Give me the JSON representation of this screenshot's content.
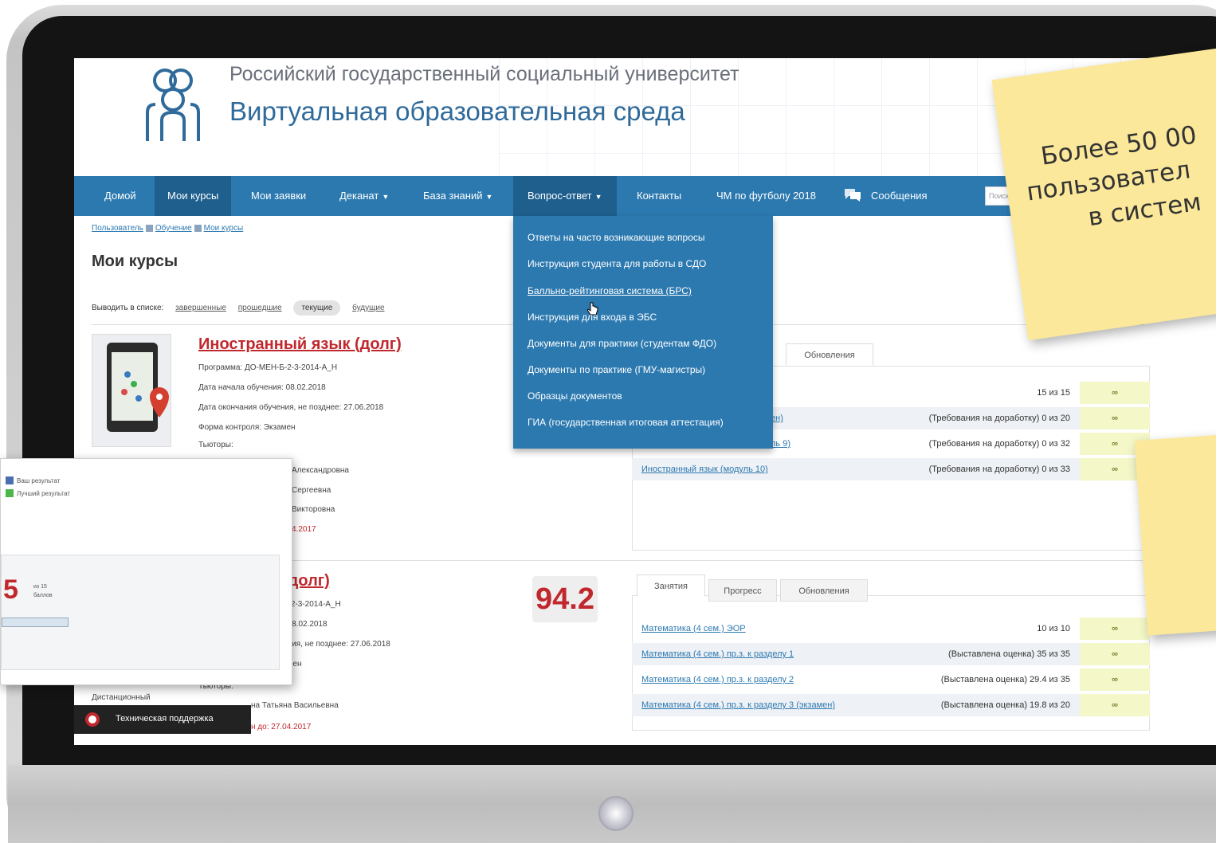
{
  "header": {
    "university": "Российский государственный социальный университет",
    "title": "Виртуальная образовательная среда"
  },
  "nav": {
    "items": [
      "Домой",
      "Мои курсы",
      "Мои заявки",
      "Деканат",
      "База знаний",
      "Вопрос-ответ",
      "Контакты",
      "ЧМ по футболу 2018",
      "Сообщения"
    ],
    "search_placeholder": "Поиск"
  },
  "breadcrumb": [
    "Пользователь",
    "Обучение",
    "Мои курсы"
  ],
  "page_title": "Мои курсы",
  "filters": {
    "label": "Выводить в списке:",
    "options": [
      "завершенные",
      "прошедшие",
      "текущие",
      "будущие"
    ],
    "selected": "текущие"
  },
  "course1": {
    "title": "Иностранный язык (долг)",
    "program": "Программа: ДО-МЕН-Б-2-3-2014-А_Н",
    "start": "Дата начала обучения: 08.02.2018",
    "end": "Дата окончания обучения, не позднее: 27.06.2018",
    "control": "Форма контроля: Экзамен",
    "tutors_label": "Тьюторы:",
    "tutor1": "Александровна",
    "tutor2": "Сергеевна",
    "tutor3": "Викторовна",
    "deadline": "4.2017",
    "tabs": [
      "Обновления"
    ],
    "rows": [
      {
        "link": "",
        "value": "15 из 15",
        "inf": "∞"
      },
      {
        "link": "ен)",
        "value": "(Требования на доработку) 0 из 20",
        "inf": "∞"
      },
      {
        "link": "ль 9)",
        "value": "(Требования на доработку) 0 из 32",
        "inf": "∞"
      },
      {
        "link": "Иностранный язык (модуль 10)",
        "value": "(Требования на доработку) 0 из 33",
        "inf": "∞"
      }
    ]
  },
  "course2": {
    "title": "(долг)",
    "program": "Б-2-3-2014-А_Н",
    "start": ": 08.02.2018",
    "end": "ения, не позднее: 27.06.2018",
    "control": "амен",
    "tutors_label": "Тьюторы:",
    "type_label": "Дистанционный",
    "tutor1": "на Татьяна Васильевна",
    "deadline": "н до: 27.04.2017",
    "score": "94.2",
    "tabs": [
      "Занятия",
      "Прогресс",
      "Обновления"
    ],
    "rows": [
      {
        "link": "Математика (4 сем.) ЭОР",
        "value": "10 из 10",
        "inf": "∞"
      },
      {
        "link": "Математика (4 сем.) пр.з. к разделу 1",
        "value": "(Выставлена оценка) 35 из 35",
        "inf": "∞"
      },
      {
        "link": "Математика (4 сем.) пр.з. к разделу 2",
        "value": "(Выставлена оценка) 29.4 из 35",
        "inf": "∞"
      },
      {
        "link": "Математика (4 сем.) пр.з. к разделу 3 (экзамен)",
        "value": "(Выставлена оценка) 19.8 из 20",
        "inf": "∞"
      }
    ]
  },
  "dropdown": {
    "items": [
      "Ответы на часто возникающие вопросы",
      "Инструкция студента для работы в СДО",
      "Балльно-рейтинговая система (БРС)",
      "Инструкция для входа в ЭБС",
      "Документы для практики (студентам ФДО)",
      "Документы по практике (ГМУ-магистры)",
      "Образцы документов",
      "ГИА (государственная итоговая аттестация)"
    ]
  },
  "overlay": {
    "legend": [
      "Ваш результат",
      "Лучший результат"
    ],
    "big_number": "5",
    "small_1": "из 15",
    "small_2": "баллов",
    "legend_colors": [
      "#4a6fb0",
      "#4cb84c"
    ]
  },
  "support": {
    "label": "Техническая поддержка"
  },
  "sticky_notes": {
    "note1": [
      "Более 50 00",
      "пользовател",
      "в систем"
    ]
  },
  "colors": {
    "accent": "#2c79b0",
    "brand_red": "#c0282d",
    "sticky": "#fbe89a"
  }
}
